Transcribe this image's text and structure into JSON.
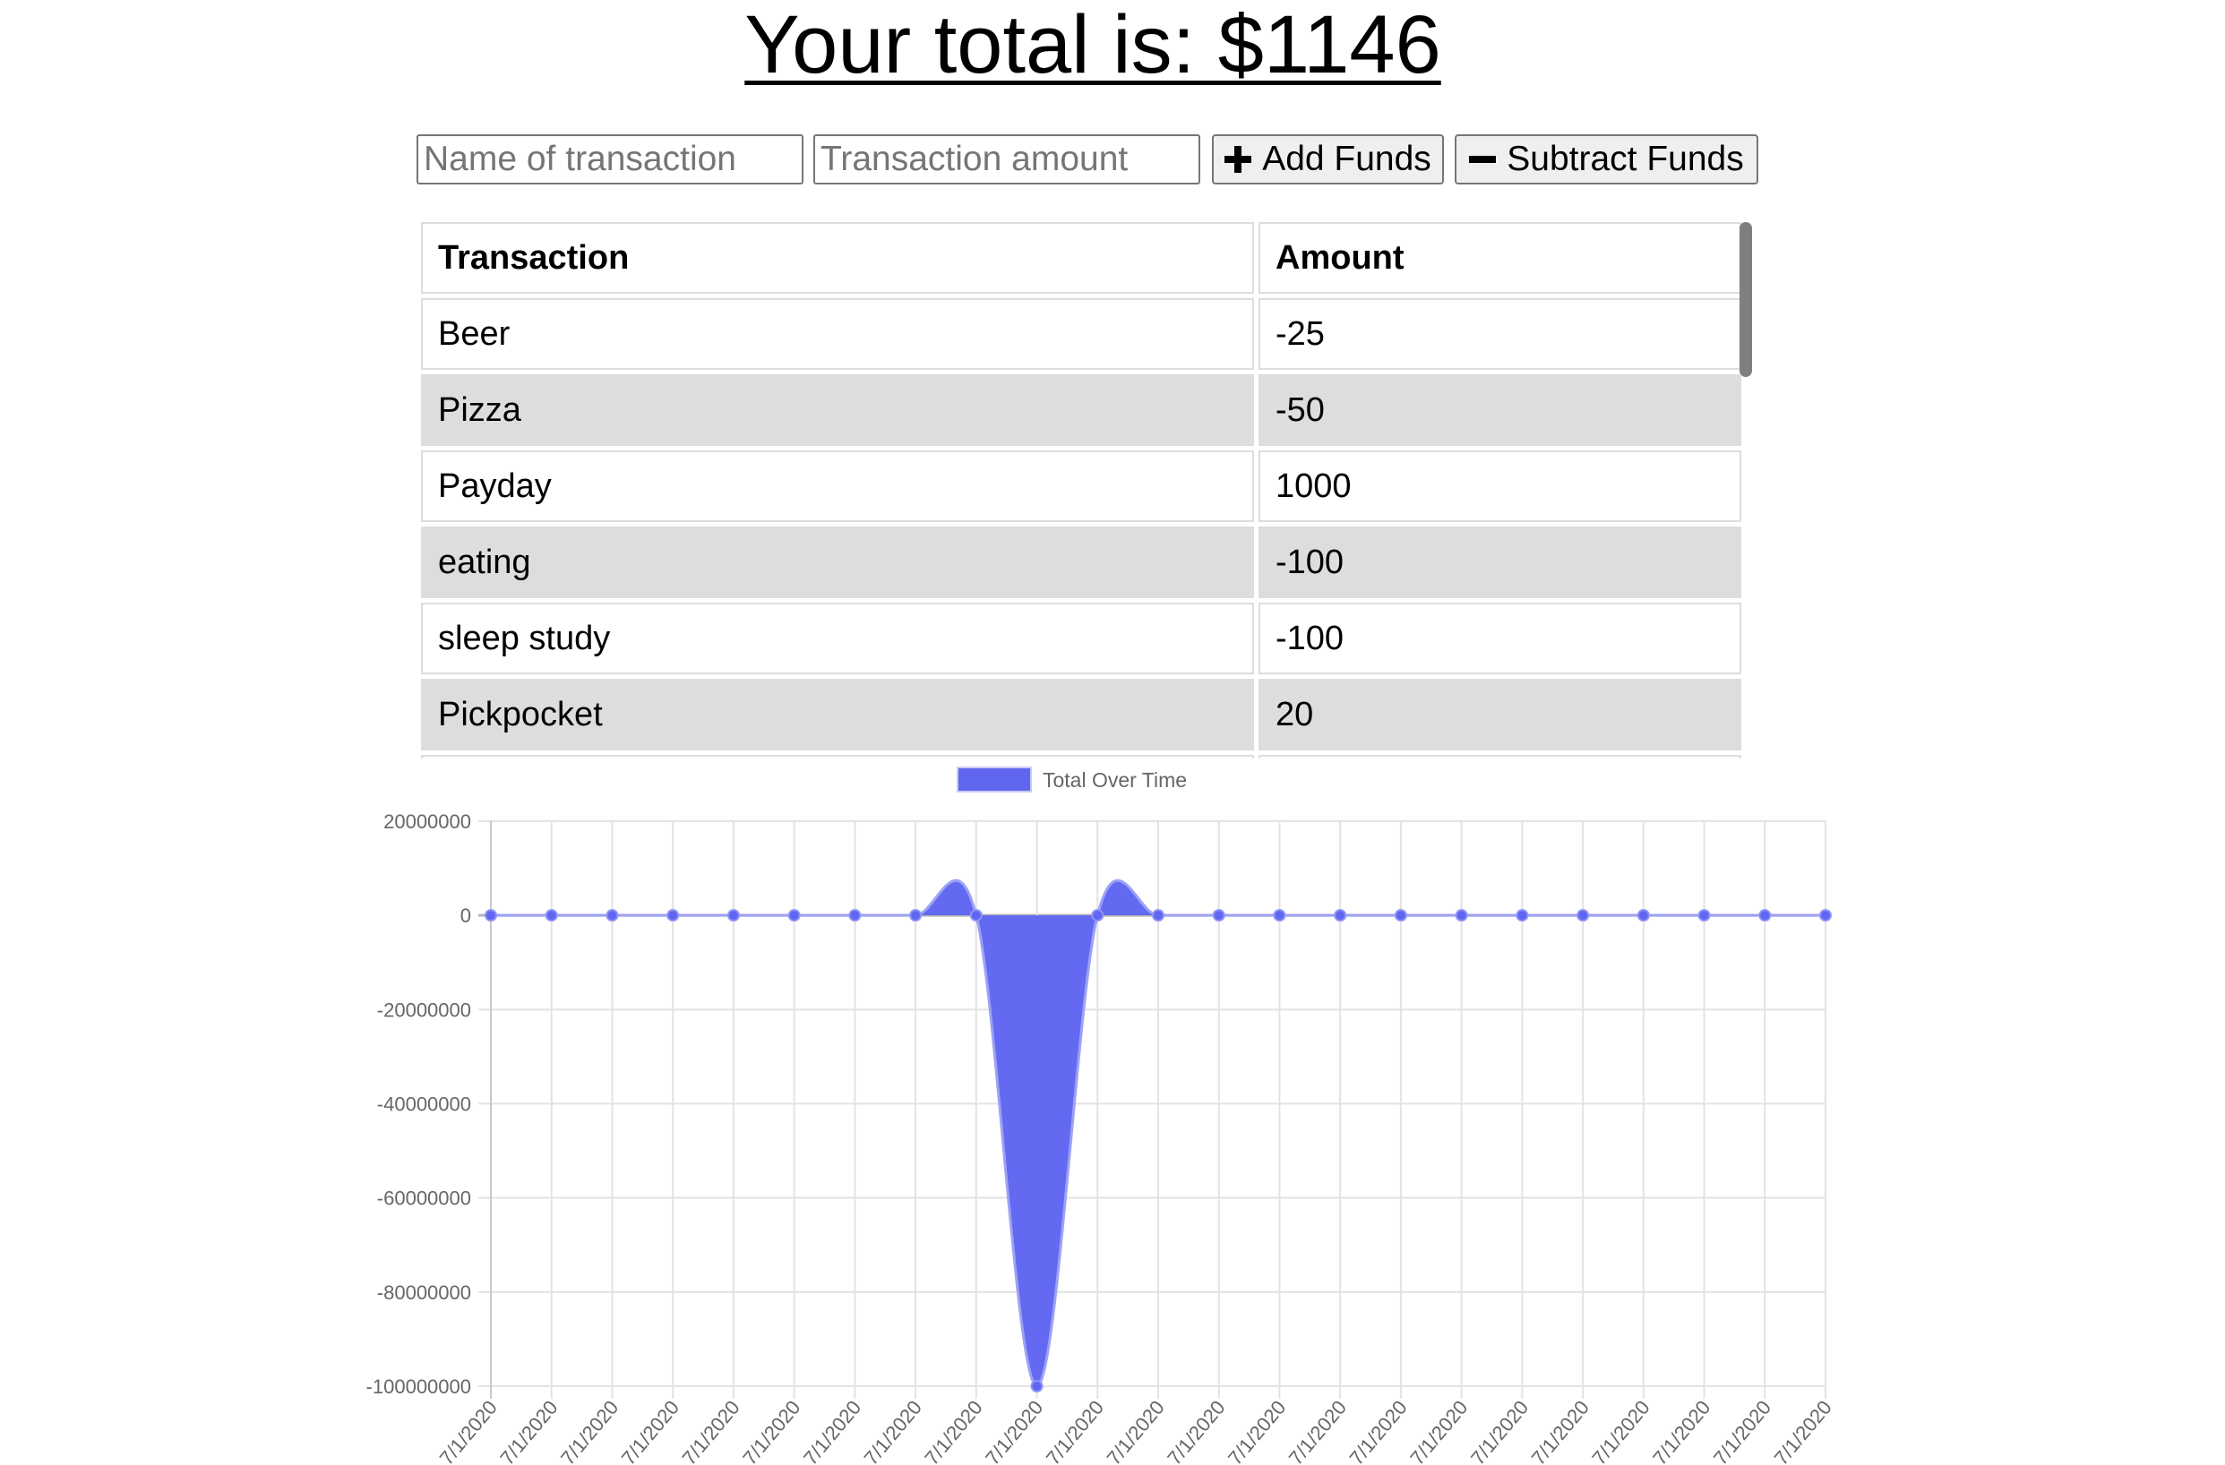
{
  "header": {
    "total_label": "Your total is: $1146"
  },
  "form": {
    "name_placeholder": "Name of transaction",
    "amount_placeholder": "Transaction amount",
    "add_label": "Add Funds",
    "add_icon": "plus-icon",
    "subtract_label": "Subtract Funds",
    "subtract_icon": "minus-icon"
  },
  "table": {
    "headers": [
      "Transaction",
      "Amount"
    ],
    "rows": [
      {
        "name": "Beer",
        "amount": "-25"
      },
      {
        "name": "Pizza",
        "amount": "-50"
      },
      {
        "name": "Payday",
        "amount": "1000"
      },
      {
        "name": "eating",
        "amount": "-100"
      },
      {
        "name": "sleep study",
        "amount": "-100"
      },
      {
        "name": "Pickpocket",
        "amount": "20"
      },
      {
        "name": "",
        "amount": ""
      }
    ],
    "row_stripe_color": "#dddddd",
    "scrollbar_thumb_color": "#7f7f7f"
  },
  "chart_data": {
    "type": "area",
    "title": "",
    "legend_label": "Total Over Time",
    "legend_position": "top",
    "xlabel": "",
    "ylabel": "",
    "x": [
      "7/1/2020",
      "7/1/2020",
      "7/1/2020",
      "7/1/2020",
      "7/1/2020",
      "7/1/2020",
      "7/1/2020",
      "7/1/2020",
      "7/1/2020",
      "7/1/2020",
      "7/1/2020",
      "7/1/2020",
      "7/1/2020",
      "7/1/2020",
      "7/1/2020",
      "7/1/2020",
      "7/1/2020",
      "7/1/2020",
      "7/1/2020",
      "7/1/2020",
      "7/1/2020",
      "7/1/2020",
      "7/1/2020"
    ],
    "series": [
      {
        "name": "Total Over Time",
        "values": [
          0,
          0,
          0,
          0,
          0,
          0,
          0,
          0,
          0,
          -100000000,
          0,
          0,
          0,
          0,
          0,
          0,
          0,
          0,
          0,
          0,
          0,
          0,
          0
        ],
        "color": "#6066f0"
      }
    ],
    "y_ticks": [
      "20000000",
      "0",
      "-20000000",
      "-40000000",
      "-60000000",
      "-80000000",
      "-100000000"
    ],
    "ylim": [
      -100000000,
      20000000
    ],
    "grid": true
  }
}
